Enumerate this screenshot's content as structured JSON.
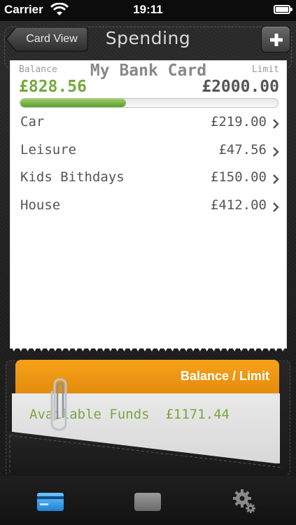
{
  "status_bar": {
    "carrier": "Carrier",
    "time": "19:11",
    "icons": [
      "wifi-icon",
      "battery-icon"
    ]
  },
  "nav": {
    "back_label": "Card View",
    "title": "Spending",
    "add_icon": "plus-icon"
  },
  "card": {
    "balance_label": "Balance",
    "name": "My Bank Card",
    "limit_label": "Limit",
    "balance": "£828.56",
    "limit": "£2000.00",
    "progress_fraction": 0.41
  },
  "categories": [
    {
      "name": "Car",
      "amount": "£219.00"
    },
    {
      "name": "Leisure",
      "amount": "£47.56"
    },
    {
      "name": "Kids Bithdays",
      "amount": "£150.00"
    },
    {
      "name": "House",
      "amount": "£412.00"
    }
  ],
  "wallet": {
    "orange_label": "Balance / Limit",
    "available_funds": "Available Funds  £1171.44"
  },
  "tab_bar": {
    "tabs": [
      {
        "icon": "credit-card-icon",
        "selected": true
      },
      {
        "icon": "card-stack-icon",
        "selected": false
      },
      {
        "icon": "gears-icon",
        "selected": false
      }
    ]
  },
  "colors": {
    "balance_green": "#76a83b",
    "orange": "#f7a21b",
    "selected_tab_blue": "#2e9ae6"
  }
}
